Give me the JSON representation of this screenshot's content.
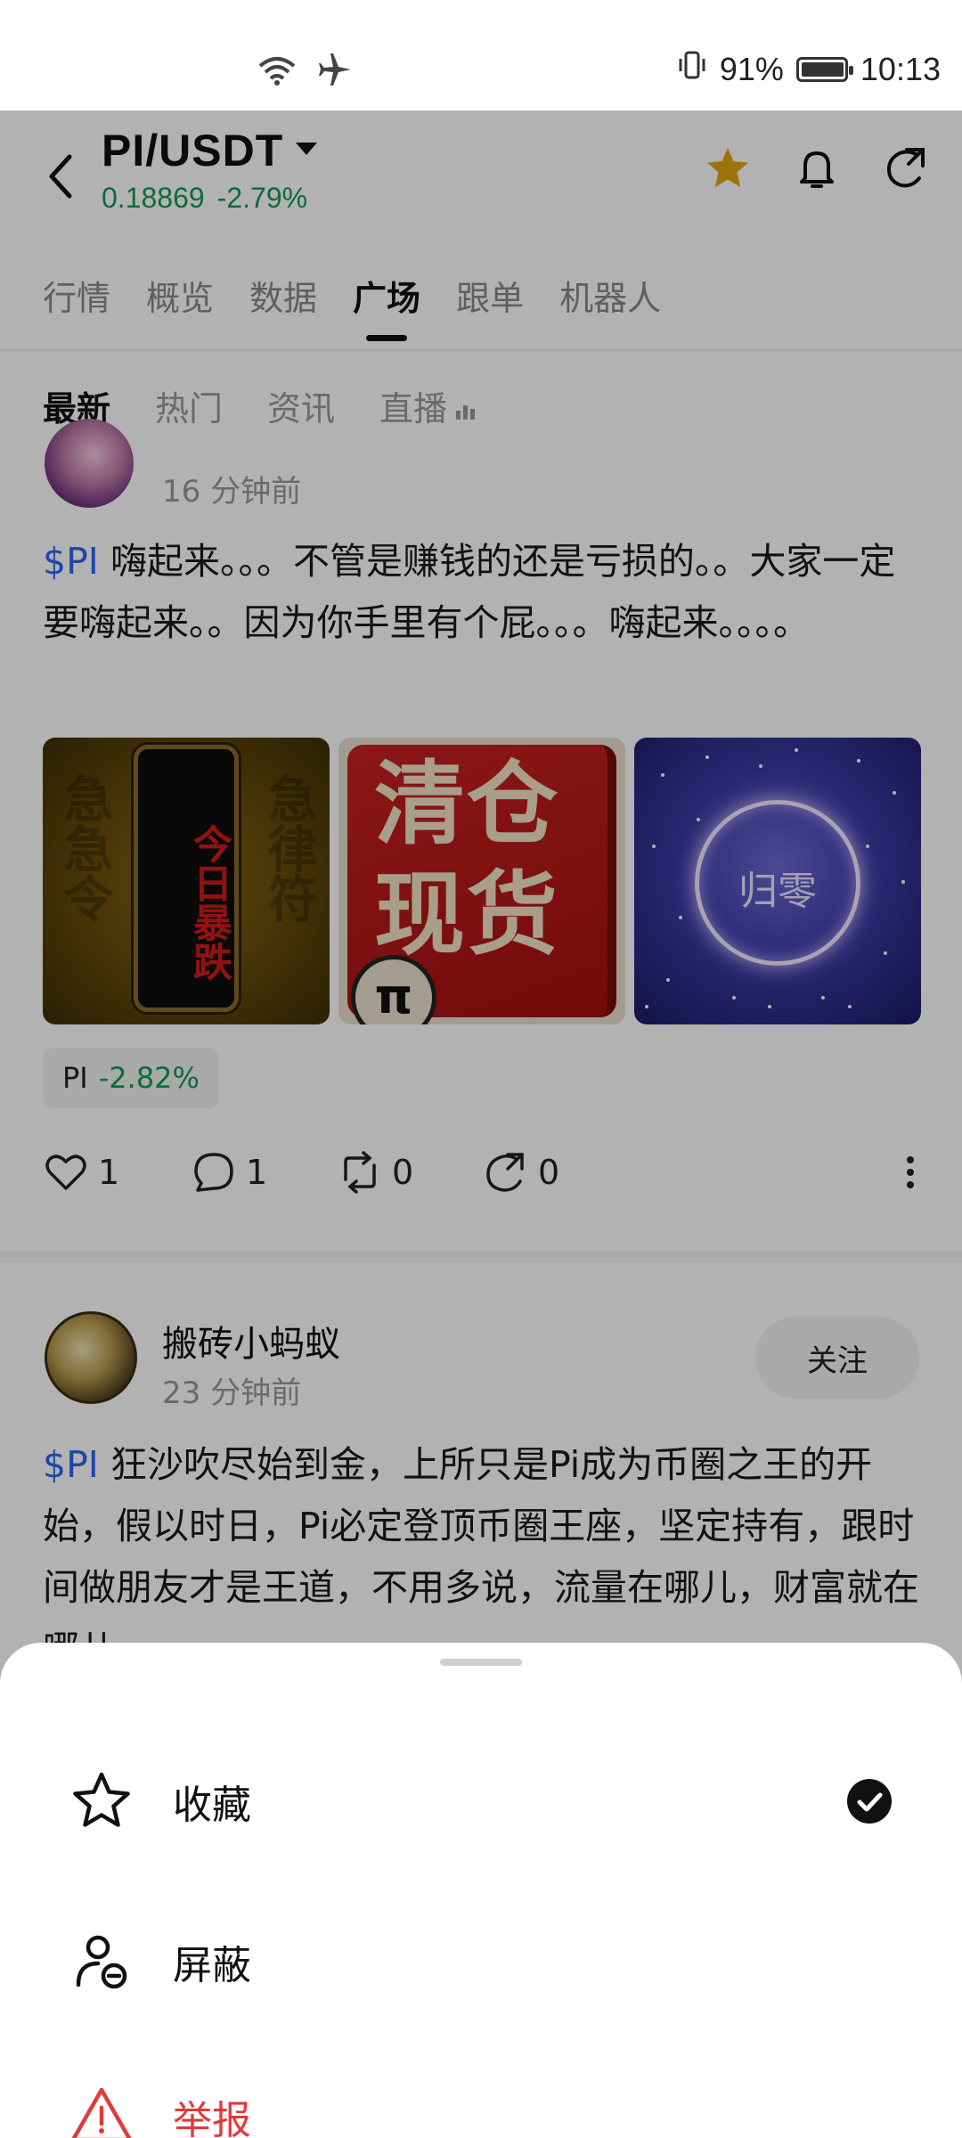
{
  "status_bar": {
    "battery_percent": "91%",
    "time": "10:13",
    "battery_level": 0.91,
    "icons": [
      "wifi-icon",
      "airplane-icon",
      "vibrate-icon",
      "battery-icon"
    ]
  },
  "header": {
    "pair": "PI/USDT",
    "price": "0.18869",
    "change": "-2.79%",
    "favorite_color": "#e0a60c",
    "icons": [
      "back-icon",
      "dropdown-caret-icon",
      "star-icon",
      "bell-icon",
      "share-icon"
    ]
  },
  "tabs": [
    {
      "label": "行情",
      "active": false
    },
    {
      "label": "概览",
      "active": false
    },
    {
      "label": "数据",
      "active": false
    },
    {
      "label": "广场",
      "active": true
    },
    {
      "label": "跟单",
      "active": false
    },
    {
      "label": "机器人",
      "active": false
    }
  ],
  "subtabs": [
    {
      "label": "最新",
      "active": true
    },
    {
      "label": "热门",
      "active": false
    },
    {
      "label": "资讯",
      "active": false
    },
    {
      "label": "直播",
      "active": false
    }
  ],
  "post1": {
    "time": "16 分钟前",
    "tag": "$PI",
    "text": " 嗨起来。。。不管是赚钱的还是亏损的。。大家一定要嗨起来。。因为你手里有个屁。。。嗨起来。。。。",
    "images": {
      "img1_text": "今日暴跌",
      "img1_bg_left": "急急令",
      "img1_bg_right": "急律符",
      "img2_text": "清仓现货",
      "img2_badge": "π",
      "img3_text": "归零"
    },
    "ticker": {
      "symbol": "PI",
      "change": "-2.82%"
    },
    "likes": "1",
    "comments": "1",
    "reposts": "0",
    "shares": "0"
  },
  "post2": {
    "name": "搬砖小蚂蚁",
    "time": "23 分钟前",
    "follow_label": "关注",
    "tag": "$PI",
    "text": " 狂沙吹尽始到金，上所只是Pi成为币圈之王的开始，假以时日，Pi必定登顶币圈王座，坚定持有，跟时间做朋友才是王道，不用多说，流量在哪儿，财富就在哪儿"
  },
  "sheet": {
    "collect_label": "收藏",
    "block_label": "屏蔽",
    "report_label": "举报",
    "collect_checked": true,
    "report_color": "#e23a3a"
  }
}
